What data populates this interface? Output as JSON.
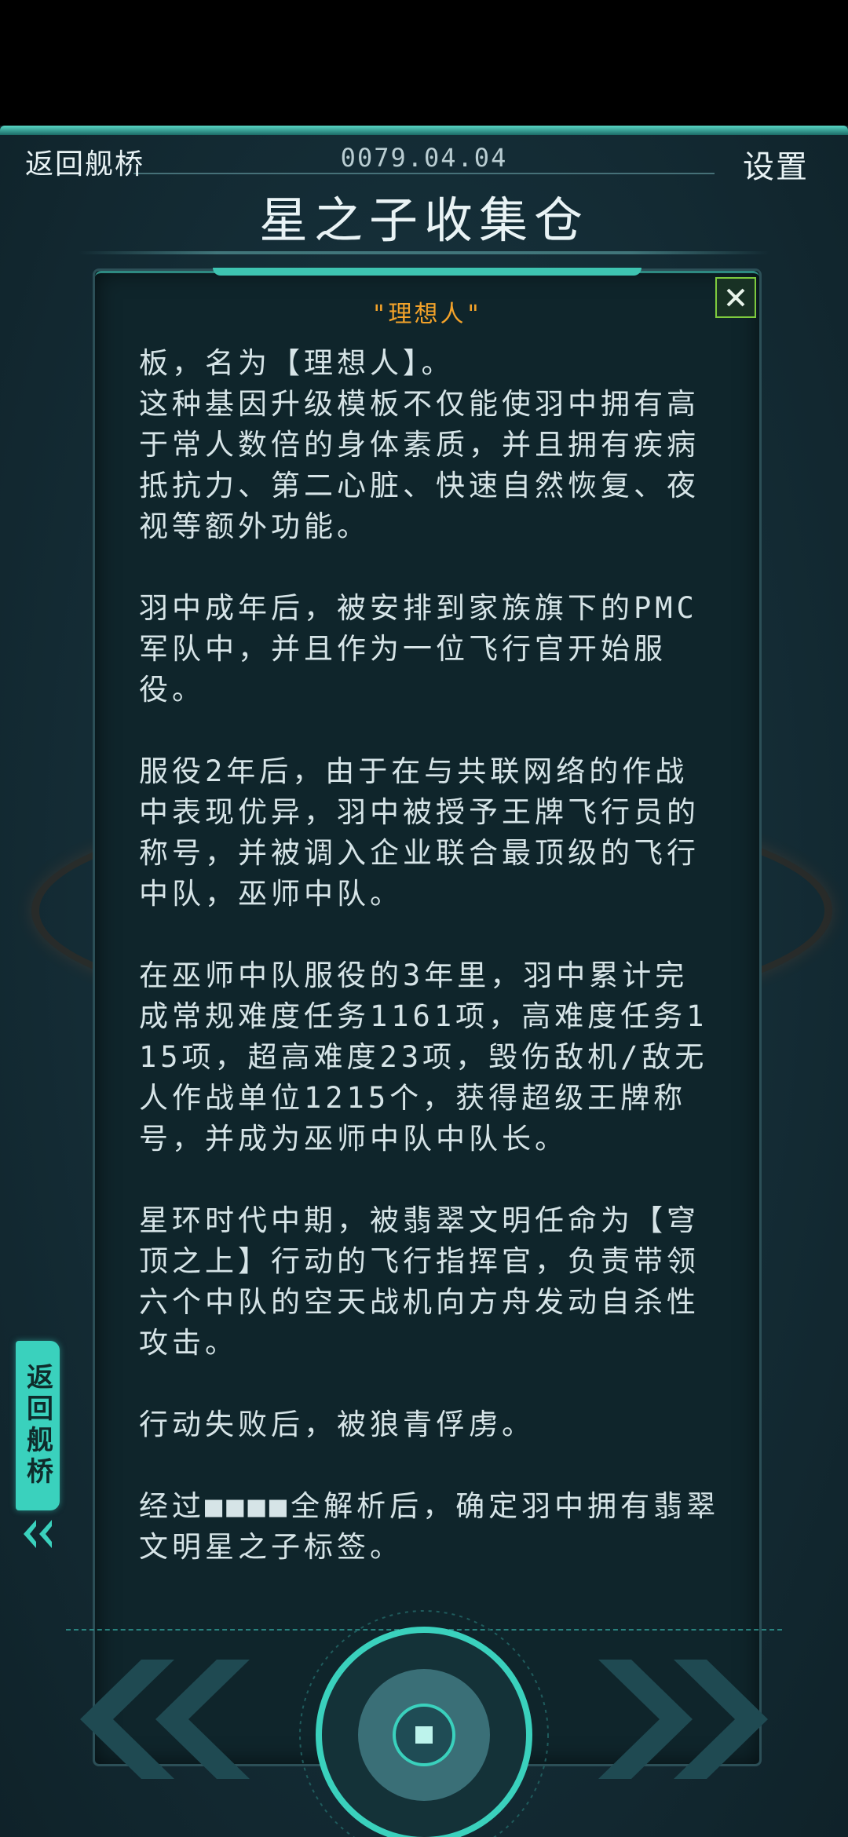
{
  "header": {
    "back_label": "返回舰桥",
    "date": "0079.04.04",
    "settings_label": "设置",
    "title": "星之子收集仓"
  },
  "panel": {
    "character_name": "\"理想人\"",
    "paragraphs": [
      "板，名为【理想人】。\n这种基因升级模板不仅能使羽中拥有高于常人数倍的身体素质，并且拥有疾病抵抗力、第二心脏、快速自然恢复、夜视等额外功能。",
      "羽中成年后，被安排到家族旗下的PMC军队中，并且作为一位飞行官开始服役。",
      "服役2年后，由于在与共联网络的作战中表现优异，羽中被授予王牌飞行员的称号，并被调入企业联合最顶级的飞行中队，巫师中队。",
      "在巫师中队服役的3年里，羽中累计完成常规难度任务1161项，高难度任务115项，超高难度23项，毁伤敌机/敌无人作战单位1215个，获得超级王牌称号，并成为巫师中队中队长。",
      "星环时代中期，被翡翠文明任命为【穹顶之上】行动的飞行指挥官，负责带领六个中队的空天战机向方舟发动自杀性攻击。",
      "行动失败后，被狼青俘虏。",
      "经过■■■■全解析后，确定羽中拥有翡翠文明星之子标签。"
    ]
  },
  "side_tab": {
    "label": "返回舰桥"
  },
  "icons": {
    "close": "close-icon",
    "side_arrows": "double-chevron-left-icon",
    "prev": "double-chevron-left-icon",
    "next": "double-chevron-right-icon",
    "center": "center-dial-icon"
  },
  "colors": {
    "accent": "#3ad1bd",
    "name": "#f2a22a",
    "close": "#7ecb3e"
  }
}
